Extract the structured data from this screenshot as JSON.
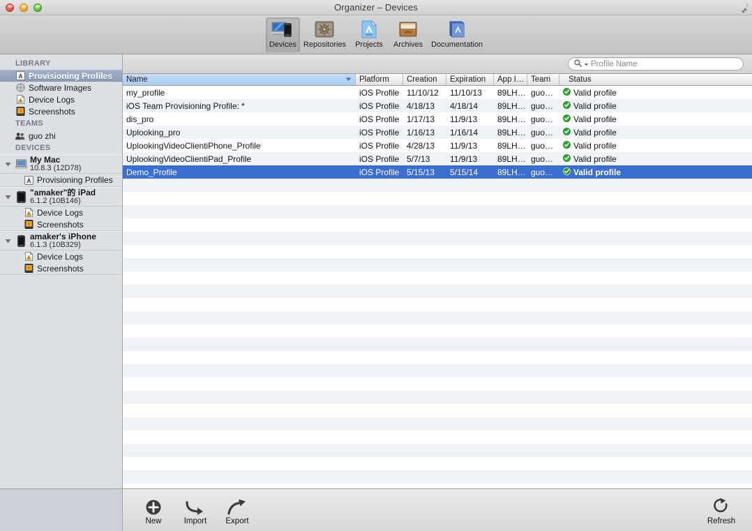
{
  "window": {
    "title": "Organizer – Devices",
    "traffic_lights": [
      "close",
      "minimize",
      "zoom"
    ],
    "fullscreen_icon": "fullscreen-expand-icon"
  },
  "toolbar": {
    "items": [
      {
        "label": "Devices",
        "icon": "devices-icon",
        "selected": true
      },
      {
        "label": "Repositories",
        "icon": "repositories-icon",
        "selected": false
      },
      {
        "label": "Projects",
        "icon": "projects-icon",
        "selected": false
      },
      {
        "label": "Archives",
        "icon": "archives-icon",
        "selected": false
      },
      {
        "label": "Documentation",
        "icon": "documentation-icon",
        "selected": false
      }
    ]
  },
  "sidebar": {
    "sections": [
      {
        "title": "LIBRARY"
      },
      {
        "title": "TEAMS"
      },
      {
        "title": "DEVICES"
      }
    ],
    "library": [
      {
        "label": "Provisioning Profiles",
        "icon": "provisioning-profile-icon",
        "selected": true
      },
      {
        "label": "Software Images",
        "icon": "software-image-icon",
        "selected": false
      },
      {
        "label": "Device Logs",
        "icon": "device-log-icon",
        "selected": false
      },
      {
        "label": "Screenshots",
        "icon": "screenshot-icon",
        "selected": false
      }
    ],
    "teams": [
      {
        "label": "guo zhi",
        "icon": "team-icon"
      }
    ],
    "devices": [
      {
        "name": "My Mac",
        "version": "10.8.3 (12D78)",
        "icon": "mac-icon",
        "expanded": true,
        "children": [
          {
            "label": "Provisioning Profiles",
            "icon": "provisioning-profile-icon"
          }
        ]
      },
      {
        "name": "\"amaker\"的 iPad",
        "version": "6.1.2 (10B146)",
        "icon": "ipad-icon",
        "expanded": true,
        "children": [
          {
            "label": "Device Logs",
            "icon": "device-log-icon"
          },
          {
            "label": "Screenshots",
            "icon": "screenshot-icon"
          }
        ]
      },
      {
        "name": "amaker's iPhone",
        "version": "6.1.3 (10B329)",
        "icon": "iphone-icon",
        "expanded": true,
        "children": [
          {
            "label": "Device Logs",
            "icon": "device-log-icon"
          },
          {
            "label": "Screenshots",
            "icon": "screenshot-icon"
          }
        ]
      }
    ]
  },
  "search": {
    "placeholder": "Profile Name",
    "value": "",
    "icon": "search-icon",
    "dropdown_icon": "chevron-down-icon"
  },
  "table": {
    "columns": [
      {
        "key": "name",
        "label": "Name",
        "sorted": true,
        "sort_dir": "descending"
      },
      {
        "key": "platform",
        "label": "Platform",
        "sorted": false
      },
      {
        "key": "creation",
        "label": "Creation",
        "sorted": false
      },
      {
        "key": "expiration",
        "label": "Expiration",
        "sorted": false
      },
      {
        "key": "app_id",
        "label": "App I…",
        "sorted": false
      },
      {
        "key": "team",
        "label": "Team",
        "sorted": false
      },
      {
        "key": "status",
        "label": "Status",
        "sorted": false
      }
    ],
    "rows": [
      {
        "name": "my_profile",
        "platform": "iOS Profile",
        "creation": "11/10/12",
        "expiration": "11/10/13",
        "app_id": "89LH…",
        "team": "guo…",
        "status": "Valid profile",
        "status_state": "valid",
        "selected": false
      },
      {
        "name": "iOS Team Provisioning Profile: *",
        "platform": "iOS Profile",
        "creation": "4/18/13",
        "expiration": "4/18/14",
        "app_id": "89LH…",
        "team": "guo…",
        "status": "Valid profile",
        "status_state": "valid",
        "selected": false
      },
      {
        "name": "dis_pro",
        "platform": "iOS Profile",
        "creation": "1/17/13",
        "expiration": "11/9/13",
        "app_id": "89LH…",
        "team": "guo…",
        "status": "Valid profile",
        "status_state": "valid",
        "selected": false
      },
      {
        "name": "Uplooking_pro",
        "platform": "iOS Profile",
        "creation": "1/16/13",
        "expiration": "1/16/14",
        "app_id": "89LH…",
        "team": "guo…",
        "status": "Valid profile",
        "status_state": "valid",
        "selected": false
      },
      {
        "name": "UplookingVideoClientiPhone_Profile",
        "platform": "iOS Profile",
        "creation": "4/28/13",
        "expiration": "11/9/13",
        "app_id": "89LH…",
        "team": "guo…",
        "status": "Valid profile",
        "status_state": "valid",
        "selected": false
      },
      {
        "name": "UplookingVideoClientiPad_Profile",
        "platform": "iOS Profile",
        "creation": "5/7/13",
        "expiration": "11/9/13",
        "app_id": "89LH…",
        "team": "guo…",
        "status": "Valid profile",
        "status_state": "valid",
        "selected": false
      },
      {
        "name": "Demo_Profile",
        "platform": "iOS Profile",
        "creation": "5/15/13",
        "expiration": "5/15/14",
        "app_id": "89LH…",
        "team": "guo…",
        "status": "Valid profile",
        "status_state": "valid",
        "selected": true
      }
    ],
    "empty_row_count": 24
  },
  "bottom_bar": {
    "left_buttons": [
      {
        "label": "New",
        "icon": "plus-circle-icon"
      },
      {
        "label": "Import",
        "icon": "import-arrow-icon"
      },
      {
        "label": "Export",
        "icon": "export-arrow-icon"
      }
    ],
    "right_buttons": [
      {
        "label": "Refresh",
        "icon": "refresh-icon"
      }
    ]
  },
  "colors": {
    "selection_blue": "#3a6ed0",
    "sidebar_selection": "#95a8c0",
    "status_green": "#2aa82a",
    "sort_header_blue": "#a9ccf2",
    "stripe": "#eff3f8"
  }
}
